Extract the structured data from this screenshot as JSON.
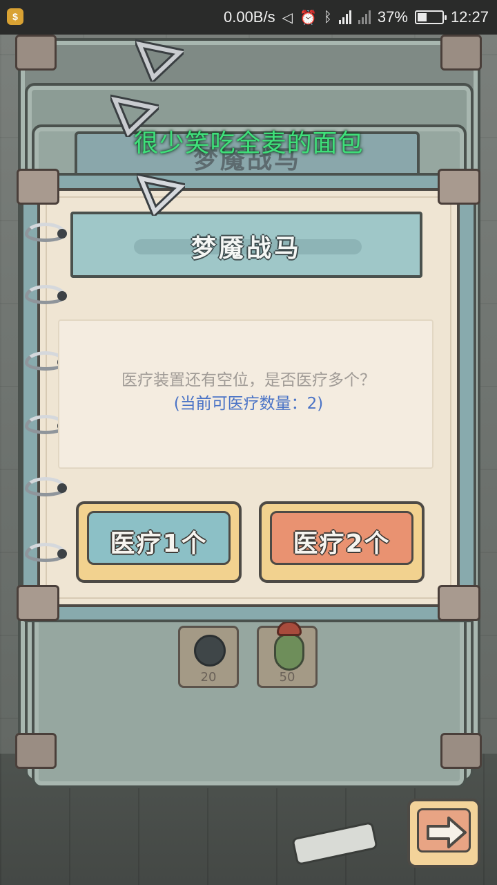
{
  "status_bar": {
    "net_speed": "0.00B/s",
    "network_type": "4G",
    "battery_percent": "37%",
    "battery_level": 0.37,
    "time": "12:27",
    "icons": [
      "app-badge-icon",
      "mute-icon",
      "alarm-icon",
      "bluetooth-vibrate-icon",
      "signal-4g-icon",
      "signal-unknown-icon",
      "battery-icon"
    ]
  },
  "scene": {
    "caption": "很少笑吃全麦的面包",
    "background_title": "梦魇战马",
    "background_slots": [
      {
        "icon": "shadow-blob-icon",
        "count": "20"
      },
      {
        "icon": "potion-icon",
        "count": "50"
      }
    ]
  },
  "dialog": {
    "title": "梦魇战马",
    "message": "医疗装置还有空位，是否医疗多个？",
    "sub_message": "(当前可医疗数量：2)",
    "buttons": {
      "heal_one": "医疗1个",
      "heal_two": "医疗2个"
    }
  },
  "next_button": {
    "icon": "right-arrow-icon"
  },
  "colors": {
    "caption": "#3fe07a",
    "sub_message": "#4a73c6",
    "heal_one": "#8cc0c6",
    "heal_two": "#e99271"
  }
}
